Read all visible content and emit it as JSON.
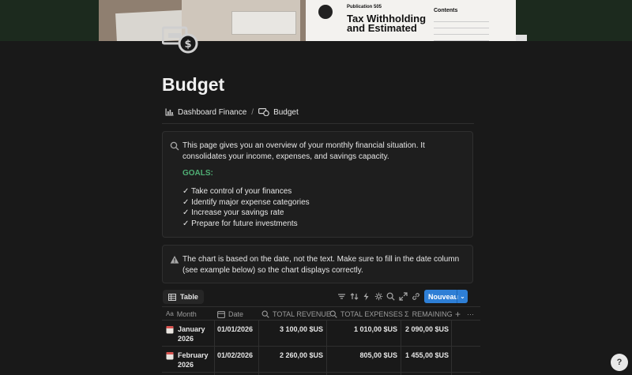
{
  "cover": {
    "publication": "Publication 505",
    "doc_title": "Tax Withholding and Estimated",
    "contents": "Contents"
  },
  "page": {
    "title": "Budget"
  },
  "breadcrumb": [
    {
      "label": "Dashboard Finance",
      "icon": "bar-chart-icon"
    },
    {
      "label": "Budget",
      "icon": "money-icon"
    }
  ],
  "breadcrumb_separator": "/",
  "callouts": {
    "overview": {
      "text": "This page gives you an overview of your monthly financial situation. It consolidates your income, expenses, and savings capacity.",
      "goals_label": "GOALS:",
      "goals": [
        "✓ Take control of your finances",
        "✓ Identify major expense categories",
        "✓ Increase your savings rate",
        "✓ Prepare for future investments"
      ]
    },
    "warning": {
      "text": "The chart is based on the date, not the text. Make sure to fill in the date column (see example below) so the chart displays correctly."
    }
  },
  "database": {
    "view_label": "Table",
    "new_button": "Nouveau",
    "new_arrow": "⌄",
    "toolbar_icons": [
      "filter-icon",
      "sort-icon",
      "automation-icon",
      "customize-icon",
      "search-icon",
      "expand-icon",
      "link-icon",
      "settings-icon"
    ],
    "columns": [
      {
        "label": "Month",
        "prefix": "Aa"
      },
      {
        "label": "Date",
        "icon": "calendar-icon"
      },
      {
        "label": "TOTAL REVENUE",
        "icon": "search-icon"
      },
      {
        "label": "TOTAL EXPENSES",
        "icon": "search-icon"
      },
      {
        "label": "REMAINING",
        "prefix": "Σ"
      }
    ],
    "rows": [
      {
        "month": "January 2026",
        "date": "01/01/2026",
        "revenue": "3 100,00 $US",
        "expenses": "1 010,00 $US",
        "remaining": "2 090,00 $US"
      },
      {
        "month": "February 2026",
        "date": "01/02/2026",
        "revenue": "2 260,00 $US",
        "expenses": "805,00 $US",
        "remaining": "1 455,00 $US"
      }
    ],
    "add_column": "+",
    "more": "···"
  },
  "help_label": "?"
}
